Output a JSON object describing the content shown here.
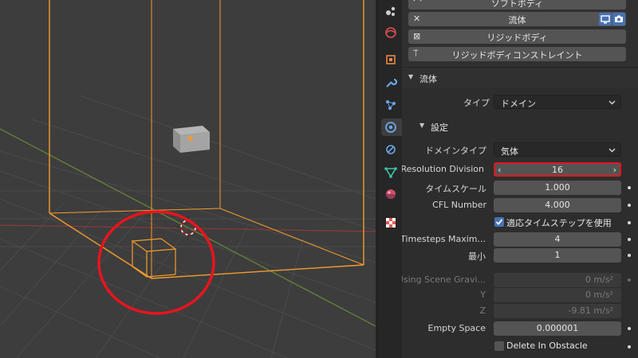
{
  "physics_buttons": [
    {
      "label": "ソフトボディ",
      "icon": "soft-body-icon"
    },
    {
      "label": "流体",
      "icon": "close-x-icon",
      "active": true
    },
    {
      "label": "リジッドボディ",
      "icon": "rigid-body-icon"
    },
    {
      "label": "リジッドボディコンストレイント",
      "icon": "constraint-icon"
    }
  ],
  "fluid_section": {
    "title": "流体",
    "type_label": "タイプ",
    "type_value": "ドメイン"
  },
  "settings_section": {
    "title": "設定",
    "domain_type_label": "ドメインタイプ",
    "domain_type_value": "気体",
    "resolution_label": "Resolution Division",
    "resolution_value": "16",
    "time_scale_label": "タイムスケール",
    "time_scale_value": "1.000",
    "cfl_label": "CFL Number",
    "cfl_value": "4.000",
    "adaptive_label": "適応タイムステップを使用",
    "adaptive_checked": true,
    "timesteps_max_label": "Timesteps Maxim...",
    "timesteps_max_value": "4",
    "min_label": "最小",
    "min_value": "1",
    "gravity_label": "Using Scene Gravi...",
    "gravity_x": "0 m/s²",
    "gravity_y_label": "Y",
    "gravity_y": "0 m/s²",
    "gravity_z_label": "Z",
    "gravity_z": "-9.81 m/s²",
    "empty_space_label": "Empty Space",
    "empty_space_value": "0.000001",
    "delete_label": "Delete In Obstacle",
    "delete_checked": false
  },
  "colors": {
    "accent": "#4772b3",
    "selection_orange": "#f39c2d",
    "highlight_red": "#e8141e"
  }
}
